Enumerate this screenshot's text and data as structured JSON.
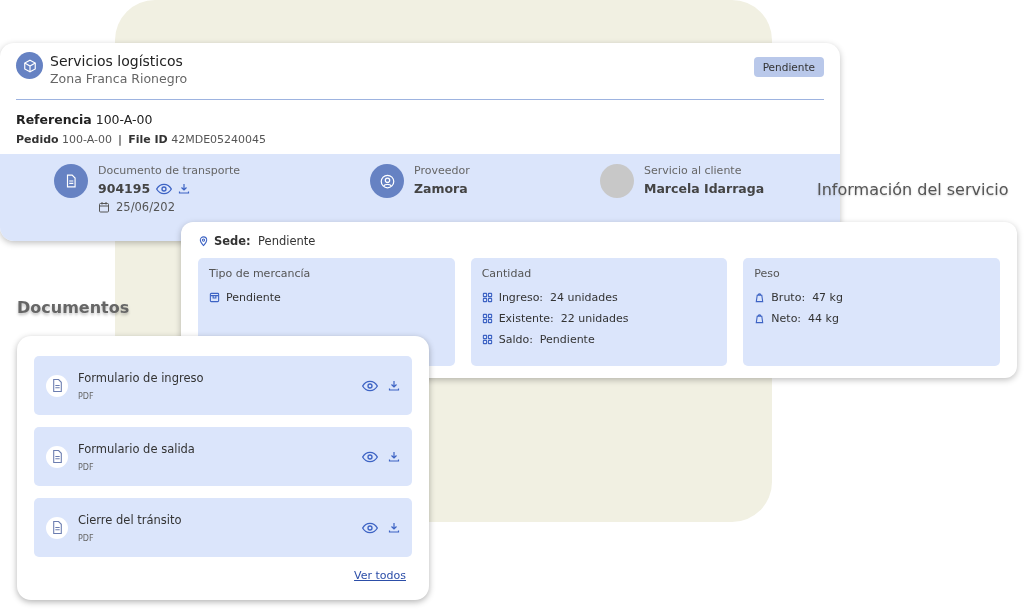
{
  "service_card": {
    "title": "Servicios logísticos",
    "subtitle": "Zona Franca Rionegro",
    "status_badge": "Pendiente",
    "reference_label": "Referencia",
    "reference": "100-A-00",
    "order_label": "Pedido",
    "order": "100-A-00",
    "separator": "|",
    "file_id_label": "File ID",
    "file_id": "42MDE05240045",
    "transport_document": {
      "label": "Documento de transporte",
      "number": "904195",
      "date": "25/06/202"
    },
    "supplier": {
      "label": "Proveedor",
      "name": "Zamora"
    },
    "customer_service": {
      "label": "Servicio al cliente",
      "name": "Marcela Idarraga"
    }
  },
  "service_info": {
    "heading": "Información del servicio",
    "site_label": "Sede:",
    "site": "Pendiente",
    "panels": [
      {
        "title": "Tipo de mercancía",
        "kind": "goods",
        "lines": [
          {
            "value": "Pendiente"
          }
        ]
      },
      {
        "title": "Cantidad",
        "kind": "quantity",
        "lines": [
          {
            "label": "Ingreso:",
            "value": "24 unidades"
          },
          {
            "label": "Existente:",
            "value": "22 unidades"
          },
          {
            "label": "Saldo:",
            "value": "Pendiente"
          }
        ]
      },
      {
        "title": "Peso",
        "kind": "weight",
        "lines": [
          {
            "label": "Bruto:",
            "value": "47 kg"
          },
          {
            "label": "Neto:",
            "value": "44 kg"
          }
        ]
      }
    ]
  },
  "documents": {
    "heading": "Documentos",
    "items": [
      {
        "name": "Formulario de ingreso",
        "type": "PDF"
      },
      {
        "name": "Formulario de salida",
        "type": "PDF"
      },
      {
        "name": "Cierre del tránsito",
        "type": "PDF"
      }
    ],
    "see_all": "Ver todos"
  }
}
